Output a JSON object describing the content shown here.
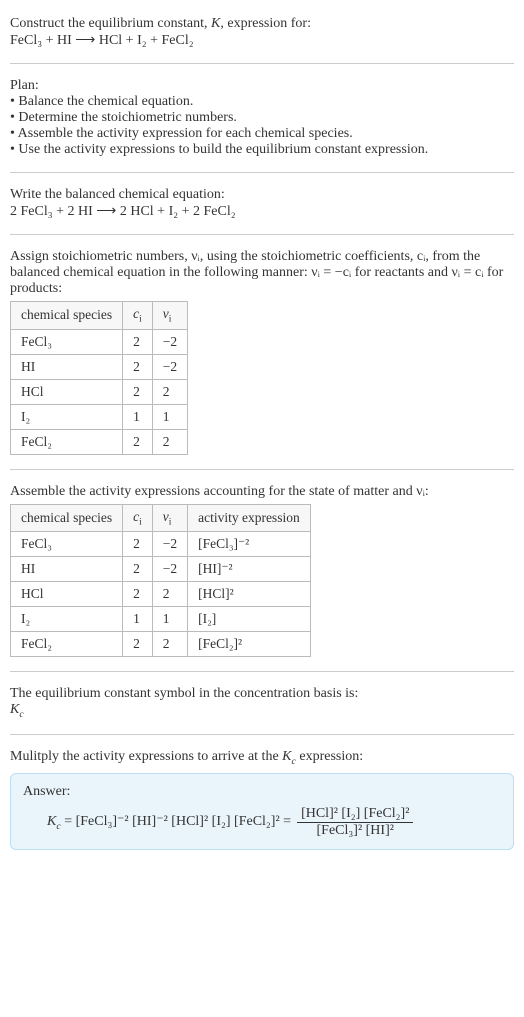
{
  "intro": {
    "line1": "Construct the equilibrium constant, K, expression for:",
    "equation": "FeCl₃ + HI ⟶ HCl + I₂ + FeCl₂"
  },
  "plan": {
    "heading": "Plan:",
    "items": [
      "• Balance the chemical equation.",
      "• Determine the stoichiometric numbers.",
      "• Assemble the activity expression for each chemical species.",
      "• Use the activity expressions to build the equilibrium constant expression."
    ]
  },
  "balanced": {
    "heading": "Write the balanced chemical equation:",
    "equation": "2 FeCl₃ + 2 HI ⟶ 2 HCl + I₂ + 2 FeCl₂"
  },
  "assign": {
    "text": "Assign stoichiometric numbers, νᵢ, using the stoichiometric coefficients, cᵢ, from the balanced chemical equation in the following manner: νᵢ = −cᵢ for reactants and νᵢ = cᵢ for products:",
    "headers": [
      "chemical species",
      "cᵢ",
      "νᵢ"
    ],
    "rows": [
      {
        "species": "FeCl₃",
        "c": "2",
        "v": "−2"
      },
      {
        "species": "HI",
        "c": "2",
        "v": "−2"
      },
      {
        "species": "HCl",
        "c": "2",
        "v": "2"
      },
      {
        "species": "I₂",
        "c": "1",
        "v": "1"
      },
      {
        "species": "FeCl₂",
        "c": "2",
        "v": "2"
      }
    ]
  },
  "activity": {
    "text": "Assemble the activity expressions accounting for the state of matter and νᵢ:",
    "headers": [
      "chemical species",
      "cᵢ",
      "νᵢ",
      "activity expression"
    ],
    "rows": [
      {
        "species": "FeCl₃",
        "c": "2",
        "v": "−2",
        "expr": "[FeCl₃]⁻²"
      },
      {
        "species": "HI",
        "c": "2",
        "v": "−2",
        "expr": "[HI]⁻²"
      },
      {
        "species": "HCl",
        "c": "2",
        "v": "2",
        "expr": "[HCl]²"
      },
      {
        "species": "I₂",
        "c": "1",
        "v": "1",
        "expr": "[I₂]"
      },
      {
        "species": "FeCl₂",
        "c": "2",
        "v": "2",
        "expr": "[FeCl₂]²"
      }
    ]
  },
  "kc_symbol": {
    "line1": "The equilibrium constant symbol in the concentration basis is:",
    "line2": "K𝑐"
  },
  "multiply": {
    "text": "Mulitply the activity expressions to arrive at the K𝑐 expression:"
  },
  "answer": {
    "label": "Answer:",
    "lhs": "K𝑐 = [FeCl₃]⁻² [HI]⁻² [HCl]² [I₂] [FeCl₂]² =",
    "num": "[HCl]² [I₂] [FeCl₂]²",
    "den": "[FeCl₃]² [HI]²"
  }
}
